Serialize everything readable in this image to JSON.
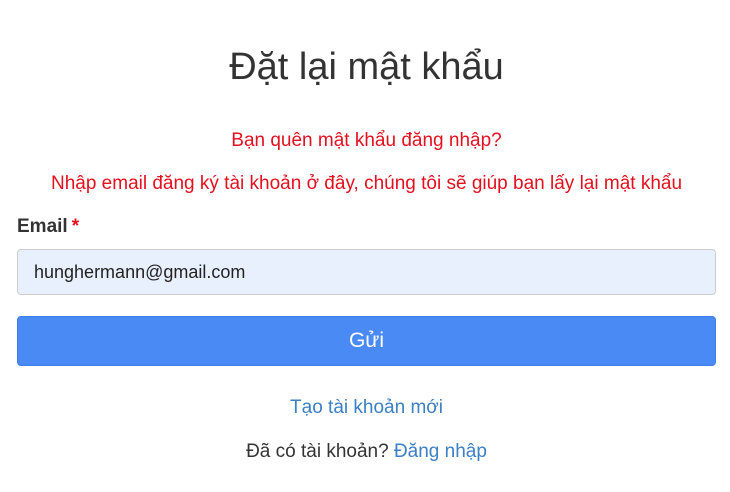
{
  "page": {
    "title": "Đặt lại mật khẩu"
  },
  "messages": {
    "question": "Bạn quên mật khẩu đăng nhập?",
    "instruction": "Nhập email đăng ký tài khoản ở đây, chúng tôi sẽ giúp bạn lấy lại mật khẩu"
  },
  "form": {
    "email_label": "Email",
    "required_mark": "*",
    "email_value": "hunghermann@gmail.com",
    "submit_label": "Gửi"
  },
  "links": {
    "create_account": "Tạo tài khoản mới",
    "have_account_text": "Đã có tài khoản?",
    "login": "Đăng nhập"
  },
  "colors": {
    "accent": "#4a8af4",
    "error_text": "#e3101f",
    "link": "#3b7fc4",
    "input_bg": "#e8f0fe"
  }
}
